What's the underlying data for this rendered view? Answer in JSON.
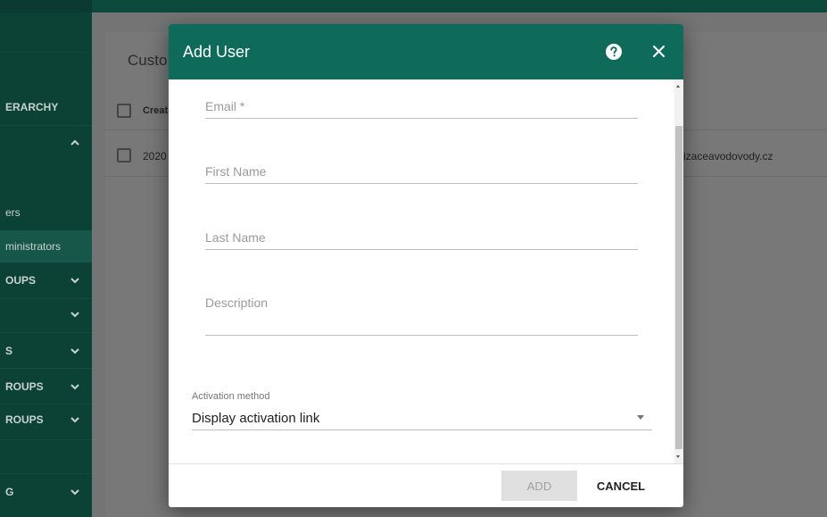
{
  "sidebar": {
    "items": [
      {
        "label": "ERARCHY"
      },
      {
        "label": "ers"
      },
      {
        "label": "ministrators"
      },
      {
        "label": "OUPS"
      },
      {
        "label": ""
      },
      {
        "label": "S"
      },
      {
        "label": "ROUPS"
      },
      {
        "label": "ROUPS"
      },
      {
        "label": "G"
      }
    ]
  },
  "background": {
    "card_title": "Custo",
    "header_cell": "Creat",
    "row_date": "2020",
    "row_email": "izaceavodovody.cz"
  },
  "dialog": {
    "title": "Add User",
    "fields": {
      "email_label": "Email *",
      "first_name_label": "First Name",
      "last_name_label": "Last Name",
      "description_label": "Description"
    },
    "activation": {
      "label": "Activation method",
      "value": "Display activation link"
    },
    "buttons": {
      "add": "ADD",
      "cancel": "CANCEL"
    }
  },
  "colors": {
    "header": "#0e6b5a",
    "sidebar": "#0c4136"
  }
}
